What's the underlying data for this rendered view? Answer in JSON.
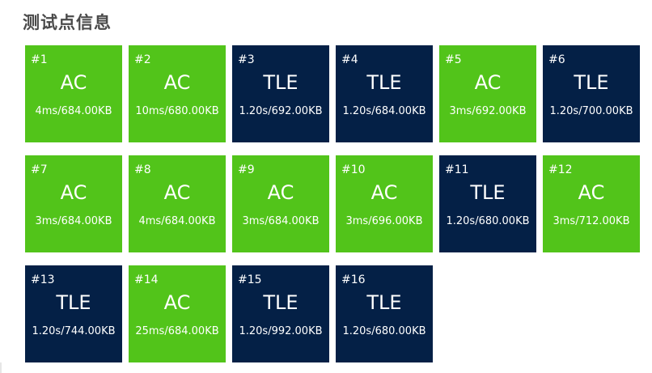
{
  "title": "测试点信息",
  "colors": {
    "ac": "#52c41a",
    "tle": "#042046",
    "title_text": "#4a4a4a"
  },
  "testcases": [
    {
      "id": "#1",
      "status": "AC",
      "stats": "4ms/684.00KB"
    },
    {
      "id": "#2",
      "status": "AC",
      "stats": "10ms/680.00KB"
    },
    {
      "id": "#3",
      "status": "TLE",
      "stats": "1.20s/692.00KB"
    },
    {
      "id": "#4",
      "status": "TLE",
      "stats": "1.20s/684.00KB"
    },
    {
      "id": "#5",
      "status": "AC",
      "stats": "3ms/692.00KB"
    },
    {
      "id": "#6",
      "status": "TLE",
      "stats": "1.20s/700.00KB"
    },
    {
      "id": "#7",
      "status": "AC",
      "stats": "3ms/684.00KB"
    },
    {
      "id": "#8",
      "status": "AC",
      "stats": "4ms/684.00KB"
    },
    {
      "id": "#9",
      "status": "AC",
      "stats": "3ms/684.00KB"
    },
    {
      "id": "#10",
      "status": "AC",
      "stats": "3ms/696.00KB"
    },
    {
      "id": "#11",
      "status": "TLE",
      "stats": "1.20s/680.00KB"
    },
    {
      "id": "#12",
      "status": "AC",
      "stats": "3ms/712.00KB"
    },
    {
      "id": "#13",
      "status": "TLE",
      "stats": "1.20s/744.00KB"
    },
    {
      "id": "#14",
      "status": "AC",
      "stats": "25ms/684.00KB"
    },
    {
      "id": "#15",
      "status": "TLE",
      "stats": "1.20s/992.00KB"
    },
    {
      "id": "#16",
      "status": "TLE",
      "stats": "1.20s/680.00KB"
    }
  ]
}
